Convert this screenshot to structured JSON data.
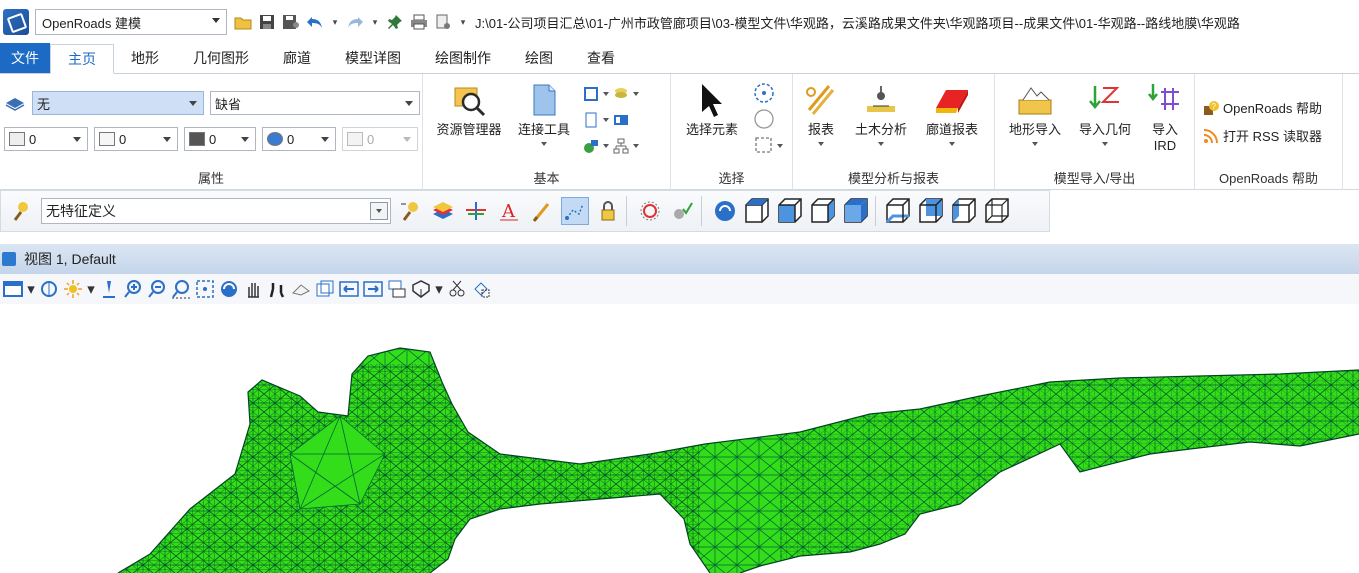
{
  "qat": {
    "workflow": "OpenRoads 建模",
    "path": "J:\\01-公司项目汇总\\01-广州市政管廊项目\\03-模型文件\\华观路，云溪路成果文件夹\\华观路项目--成果文件\\01-华观路--路线地膜\\华观路"
  },
  "tabs": [
    "文件",
    "主页",
    "地形",
    "几何图形",
    "廊道",
    "模型详图",
    "绘图制作",
    "绘图",
    "查看"
  ],
  "properties": {
    "level": "无",
    "style": "缺省",
    "color": "0",
    "weight": "0",
    "line_style": "0",
    "transparency": "0",
    "priority": "0",
    "label": "属性"
  },
  "basic": {
    "explorer": "资源管理器",
    "attach": "连接工具",
    "label": "基本"
  },
  "select": {
    "select_element": "选择元素",
    "label": "选择"
  },
  "analysis": {
    "report": "报表",
    "earthwork": "土木分析",
    "corridor_report": "廊道报表",
    "label": "模型分析与报表"
  },
  "import_export": {
    "terrain_import": "地形导入",
    "geometry_import": "导入几何",
    "ird_import_1": "导入",
    "ird_import_2": "IRD",
    "label": "模型导入/导出"
  },
  "help": {
    "help_link": "OpenRoads 帮助",
    "rss": "打开 RSS 读取器",
    "label": "OpenRoads 帮助"
  },
  "feature": {
    "value": "无特征定义"
  },
  "view": {
    "title": "视图 1, Default"
  },
  "colors": {
    "terrain_fill": "#33dd1a",
    "accent": "#1c6ac4"
  }
}
